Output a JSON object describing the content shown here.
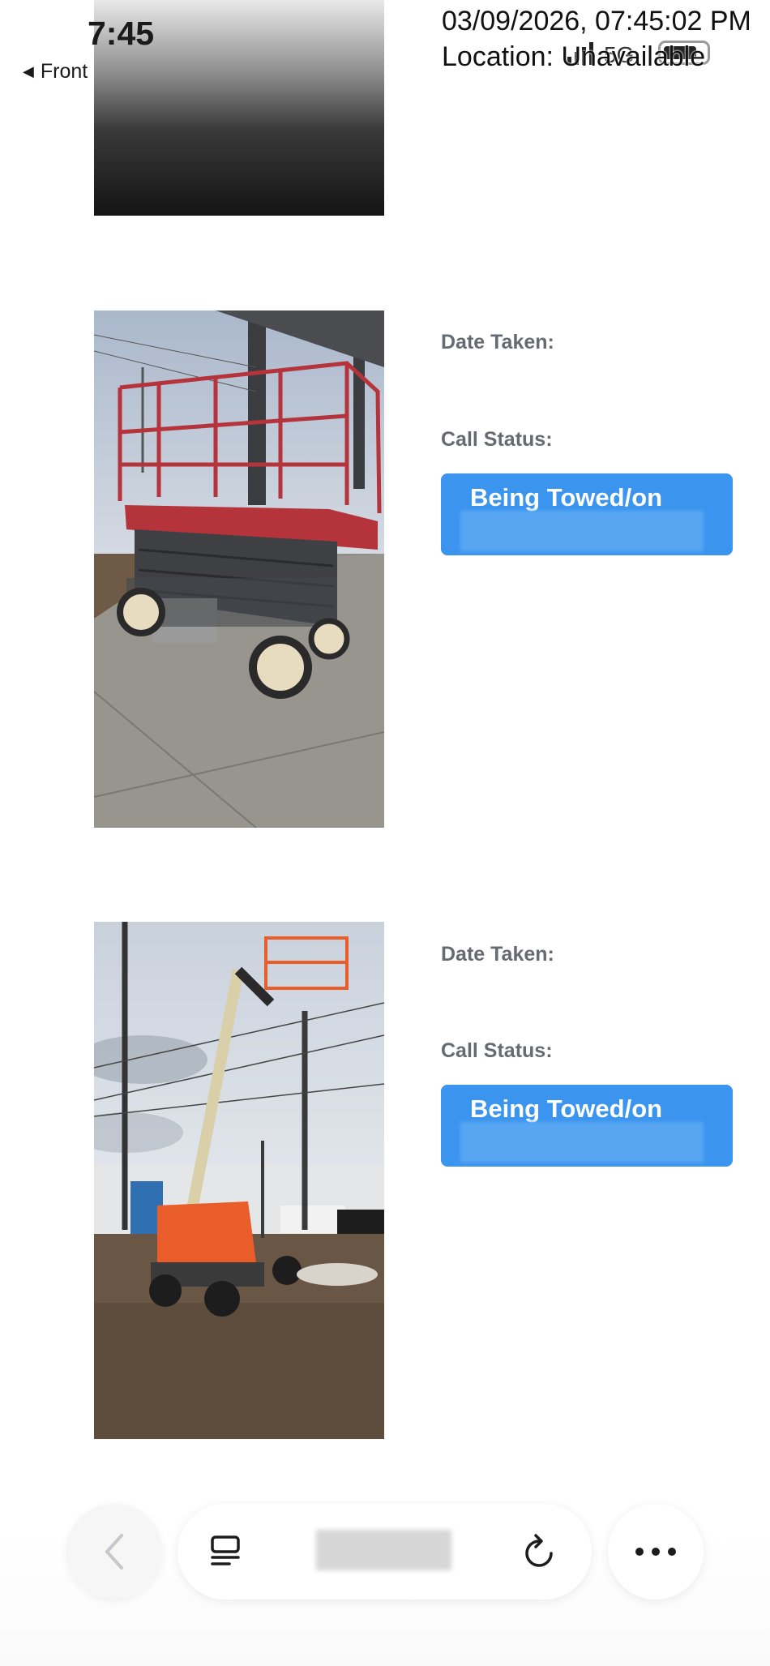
{
  "status_bar": {
    "time": "7:45",
    "back_app": "Front",
    "network": "5G"
  },
  "overlay": {
    "timestamp": "03/09/2026, 07:45:02 PM",
    "location": "Location: Unavailable"
  },
  "items": [
    {
      "date_label": "Date Taken:",
      "call_status_label": "Call Status:",
      "call_status_value": "Being Towed/on"
    },
    {
      "date_label": "Date Taken:",
      "call_status_label": "Call Status:",
      "call_status_value": "Being Towed/on"
    }
  ],
  "colors": {
    "status_button": "#3b95ee",
    "label_text": "#666a73",
    "scissor_lift": "#b5333b",
    "boom_lift": "#e85d2a"
  },
  "toolbar": {
    "icons": [
      "chevron-left-icon",
      "tabs-icon",
      "reload-icon",
      "more-icon"
    ]
  }
}
